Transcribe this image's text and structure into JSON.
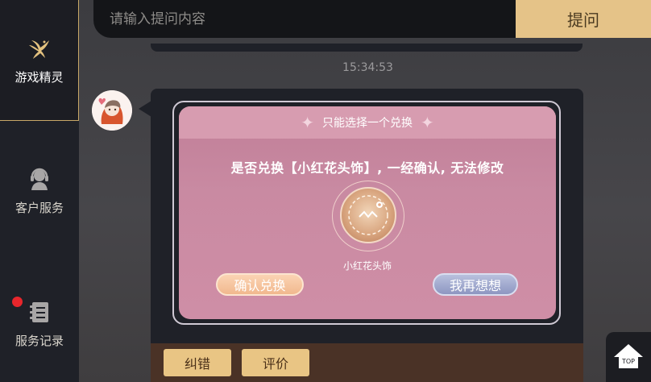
{
  "sidebar": {
    "items": [
      {
        "label": "游戏精灵",
        "icon": "fairy-icon",
        "active": true
      },
      {
        "label": "客户服务",
        "icon": "customer-service-icon",
        "active": false
      },
      {
        "label": "服务记录",
        "icon": "records-icon",
        "active": false,
        "badge": true
      }
    ]
  },
  "search": {
    "placeholder": "请输入提问内容",
    "value": "",
    "submit_label": "提问"
  },
  "chat": {
    "timestamp": "15:34:53",
    "card": {
      "header": "只能选择一个兑换",
      "question": "是否兑换【小红花头饰】, 一经确认, 无法修改",
      "item_name": "小红花头饰",
      "confirm_label": "确认兑换",
      "cancel_label": "我再想想"
    },
    "actions": {
      "fix_label": "纠错",
      "rate_label": "评价"
    }
  },
  "top_button": {
    "label": "TOP"
  },
  "colors": {
    "accent_gold": "#e5c388",
    "sidebar_bg": "#1f2128",
    "card_pink": "#c98aa2",
    "badge_red": "#e8262c"
  }
}
